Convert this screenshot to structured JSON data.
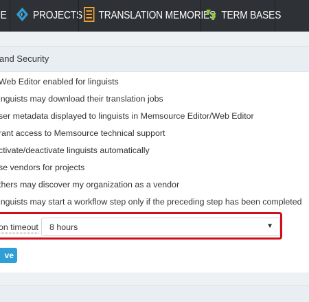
{
  "nav": {
    "home_fragment": "IE",
    "projects": "PROJECTS",
    "translation_memories": "TRANSLATION MEMORIES",
    "term_bases": "TERM BASES"
  },
  "colors": {
    "nav_bg": "#2e3236",
    "accent_blue": "#2f9fd6",
    "tm_icon": "#f0a030",
    "tb_icon": "#8dc63f",
    "highlight": "#d10f1b"
  },
  "panel": {
    "title": "and Security",
    "options": [
      "Web Editor enabled for linguists",
      "inguists may download their translation jobs",
      "ser metadata displayed to linguists in Memsource Editor/Web Editor",
      "rant access to Memsource technical support",
      "ctivate/deactivate linguists automatically",
      "se vendors for projects",
      "thers may discover my organization as a vendor",
      "inguists may start a workflow step only if the preceding step has been completed"
    ],
    "timeout_label": "on timeout",
    "timeout_value": "8 hours",
    "save_label": "ve"
  }
}
